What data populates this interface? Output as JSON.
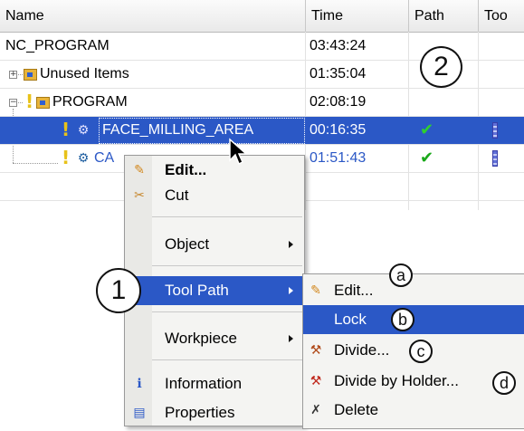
{
  "table": {
    "headers": [
      "Name",
      "Time",
      "Path",
      "Too"
    ],
    "rows": [
      {
        "name": "NC_PROGRAM",
        "time": "03:43:24",
        "path": "",
        "tool": ""
      },
      {
        "name": "Unused Items",
        "time": "01:35:04",
        "path": "",
        "tool": ""
      },
      {
        "name": "PROGRAM",
        "time": "02:08:19",
        "path": "",
        "tool": ""
      },
      {
        "name": "FACE_MILLING_AREA",
        "time": "00:16:35",
        "path": "✔",
        "tool": ""
      },
      {
        "name": "CA",
        "time": "01:51:43",
        "path": "✔",
        "tool": ""
      }
    ]
  },
  "context_menu": {
    "items": [
      {
        "label": "Edit...",
        "icon": "edit-icon"
      },
      {
        "label": "Cut",
        "icon": "cut-icon"
      },
      {
        "label": "Object",
        "icon": ""
      },
      {
        "label": "Tool Path",
        "icon": "",
        "highlighted": true
      },
      {
        "label": "Workpiece",
        "icon": ""
      },
      {
        "label": "Information",
        "icon": "info-icon"
      },
      {
        "label": "Properties",
        "icon": "properties-icon"
      }
    ]
  },
  "submenu": {
    "items": [
      {
        "label": "Edit...",
        "icon": "edit-icon"
      },
      {
        "label": "Lock",
        "icon": "",
        "highlighted": true
      },
      {
        "label": "Divide...",
        "icon": "divide-icon"
      },
      {
        "label": "Divide by Holder...",
        "icon": "divide-by-holder-icon"
      },
      {
        "label": "Delete",
        "icon": "delete-icon"
      }
    ]
  },
  "callouts": {
    "one": "1",
    "two": "2",
    "a": "a",
    "b": "b",
    "c": "c",
    "d": "d"
  },
  "colors": {
    "selection": "#2b58c6",
    "check": "#19a819",
    "folder": "#e8b43a",
    "menu_bg": "#f4f4f2"
  }
}
